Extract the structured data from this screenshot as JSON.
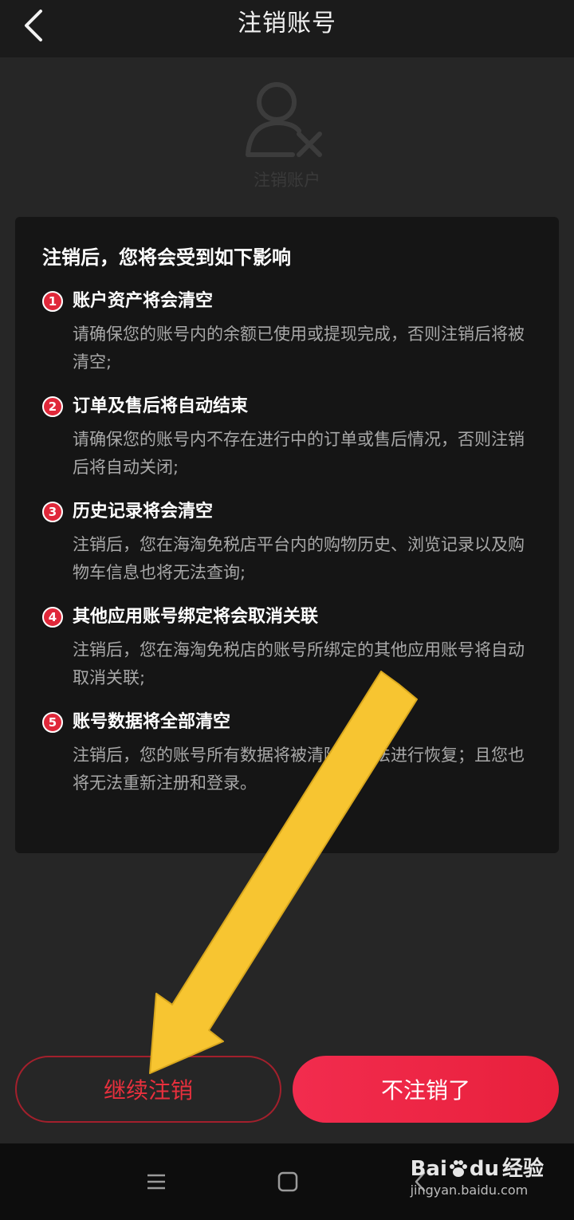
{
  "header": {
    "title": "注销账号"
  },
  "hero": {
    "icon": "user-remove-icon",
    "caption": "注销账户"
  },
  "impact": {
    "heading": "注销后，您将会受到如下影响",
    "items": [
      {
        "num": "1",
        "title": "账户资产将会清空",
        "desc": "请确保您的账号内的余额已使用或提现完成，否则注销后将被清空;"
      },
      {
        "num": "2",
        "title": "订单及售后将自动结束",
        "desc": "请确保您的账号内不存在进行中的订单或售后情况，否则注销后将自动关闭;"
      },
      {
        "num": "3",
        "title": "历史记录将会清空",
        "desc": "注销后，您在海淘免税店平台内的购物历史、浏览记录以及购物车信息也将无法查询;"
      },
      {
        "num": "4",
        "title": "其他应用账号绑定将会取消关联",
        "desc": "注销后，您在海淘免税店的账号所绑定的其他应用账号将自动取消关联;"
      },
      {
        "num": "5",
        "title": "账号数据将全部清空",
        "desc": "注销后，您的账号所有数据将被清除，无法进行恢复；且您也将无法重新注册和登录。"
      }
    ]
  },
  "actions": {
    "continue_label": "继续注销",
    "cancel_label": "不注销了"
  },
  "watermark": {
    "brand": "Bai",
    "brand_suffix": "du",
    "product": "经验",
    "url": "jingyan.baidu.com"
  },
  "colors": {
    "accent": "#e8203c",
    "background": "#262626",
    "card": "#151515",
    "arrow": "#f7c531"
  }
}
